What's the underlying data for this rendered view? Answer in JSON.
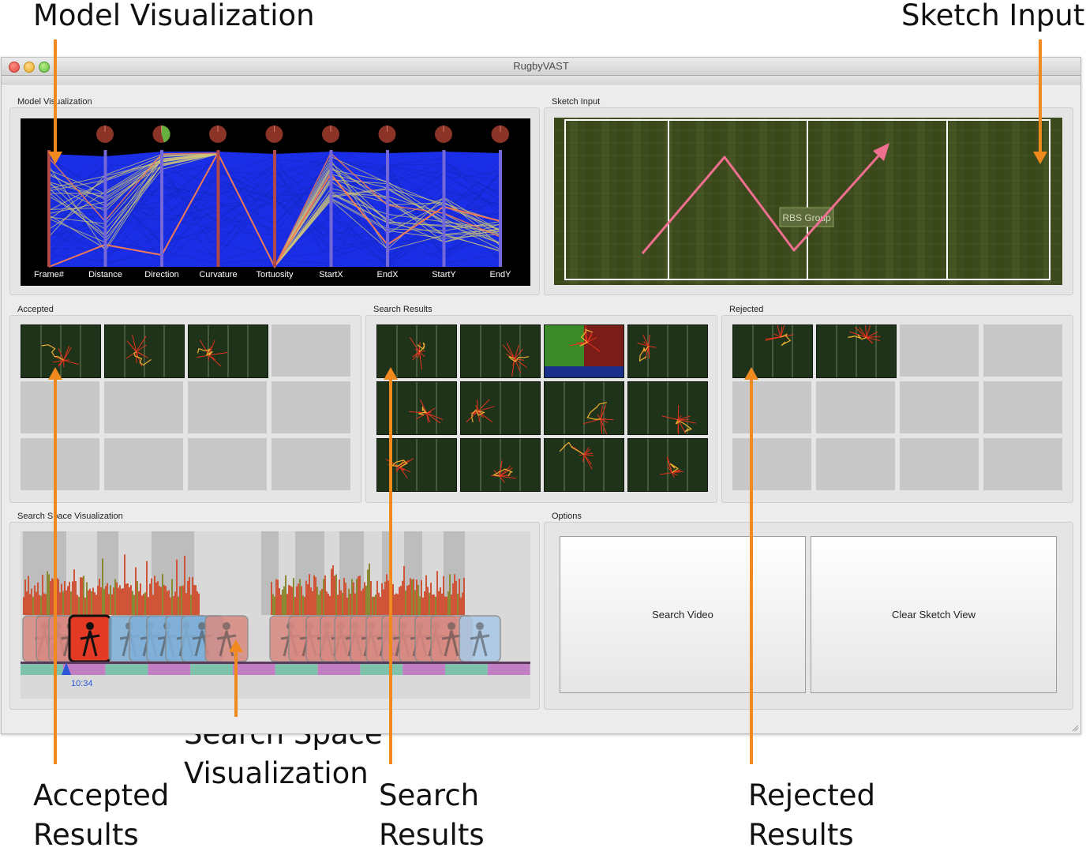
{
  "callouts": {
    "model_visualization": "Model Visualization",
    "sketch_input": "Sketch Input",
    "search_space_visualization": "Search Space\nVisualization",
    "accepted_results": "Accepted\nResults",
    "search_results": "Search\nResults",
    "rejected_results": "Rejected\nResults"
  },
  "window": {
    "title": "RugbyVAST"
  },
  "panels": {
    "model_visualization": "Model Visualization",
    "sketch_input": "Sketch Input",
    "accepted": "Accepted",
    "search_results": "Search Results",
    "rejected": "Rejected",
    "search_space_visualization": "Search Space Visualization",
    "options": "Options"
  },
  "model_axes": [
    "Frame#",
    "Distance",
    "Direction",
    "Curvature",
    "Tortuosity",
    "StartX",
    "EndX",
    "StartY",
    "EndY"
  ],
  "field_banner": "RBS Group",
  "timeline": {
    "time_label": "10:34"
  },
  "options": {
    "search_video_label": "Search Video",
    "clear_sketch_label": "Clear Sketch View"
  },
  "grids": {
    "accepted_filled": 3,
    "search_results_filled": 12,
    "rejected_filled": 2,
    "slots_per_grid": 12
  },
  "colors": {
    "callout_arrow": "#f08a1f",
    "pcp_background": "#000000",
    "pcp_blue": "#1c33ff",
    "pcp_axis": "#7468d8",
    "pcp_highlight": "#f07a55",
    "pcp_yellow": "#cfc57a",
    "field_green": "#3d4a1d",
    "sketch_pink": "#ee6f8f",
    "thumb_bg": "#1e3319",
    "track_red": "#e3321f",
    "slider_blue": "#2a56d8"
  }
}
